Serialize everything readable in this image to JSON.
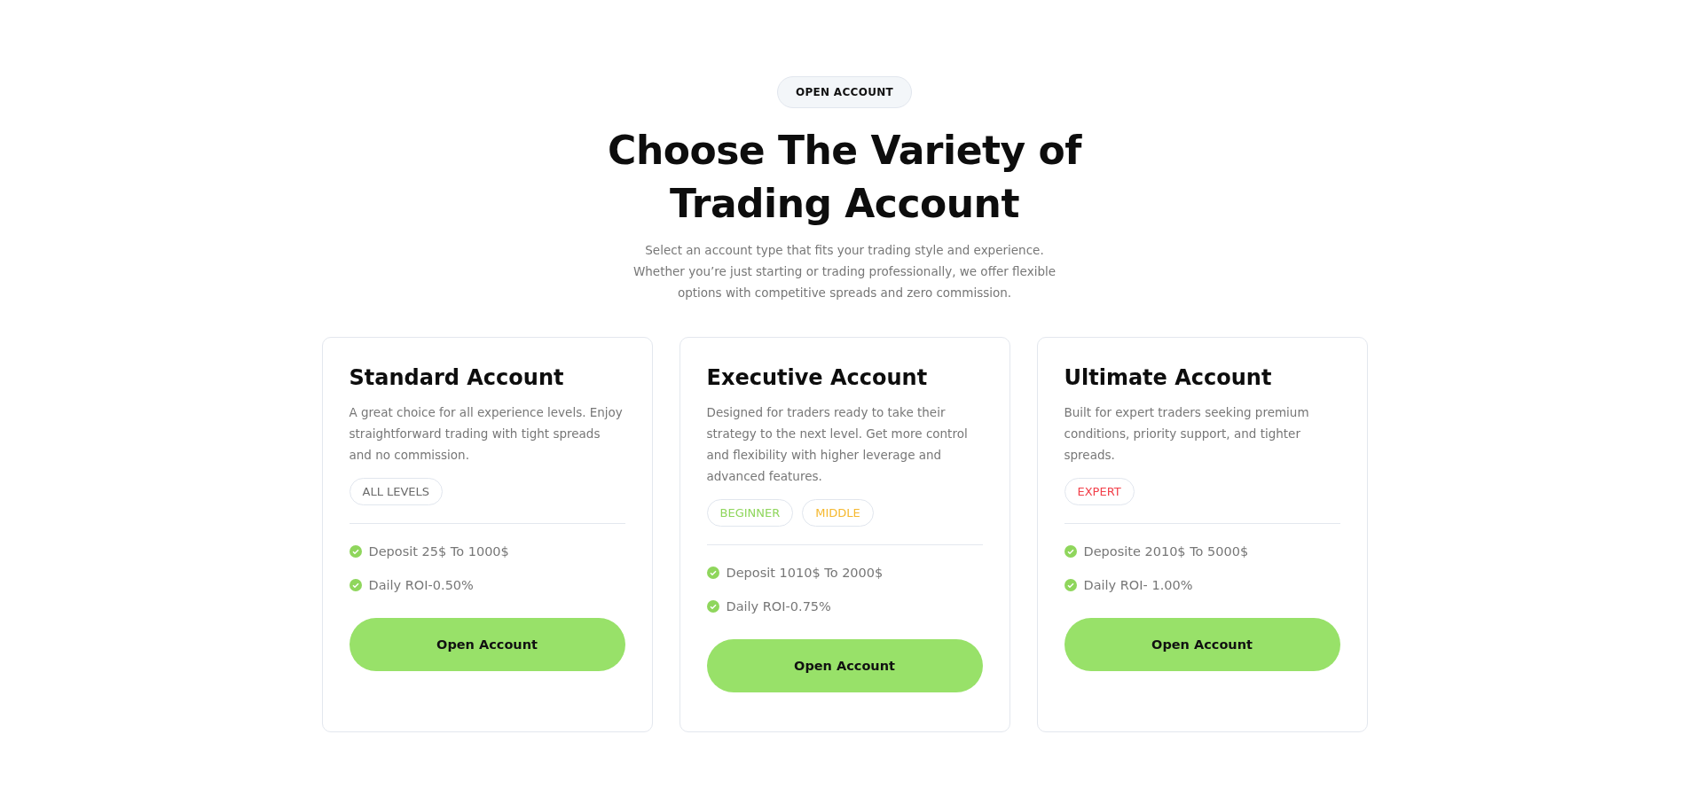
{
  "section": {
    "badge": "OPEN ACCOUNT",
    "title": "Choose The Variety of Trading Account",
    "subtitle": "Select an account type that fits your trading style and experience. Whether you’re just starting or trading professionally, we offer flexible options with competitive spreads and zero commission."
  },
  "plans": [
    {
      "name": "Standard Account",
      "description": "A great choice for all experience levels. Enjoy straightforward trading with tight spreads and no commission.",
      "tags": [
        {
          "label": "ALL LEVELS",
          "color": "#6b6b6b"
        }
      ],
      "features": [
        "Deposit 25$ To 1000$",
        "Daily ROI-0.50%"
      ],
      "button": "Open Account"
    },
    {
      "name": "Executive Account",
      "description": "Designed for traders ready to take their strategy to the next level. Get more control and flexibility with higher leverage and advanced features.",
      "tags": [
        {
          "label": "BEGINNER",
          "color": "#8fd65c"
        },
        {
          "label": "MIDDLE",
          "color": "#f5b82e"
        }
      ],
      "features": [
        "Deposit 1010$ To 2000$",
        "Daily ROI-0.75%"
      ],
      "button": "Open Account"
    },
    {
      "name": "Ultimate Account",
      "description": "Built for expert traders seeking premium conditions, priority support, and tighter spreads.",
      "tags": [
        {
          "label": "EXPERT",
          "color": "#f2404a"
        }
      ],
      "features": [
        "Deposite 2010$ To 5000$",
        "Daily ROI- 1.00%"
      ],
      "button": "Open Account"
    }
  ]
}
